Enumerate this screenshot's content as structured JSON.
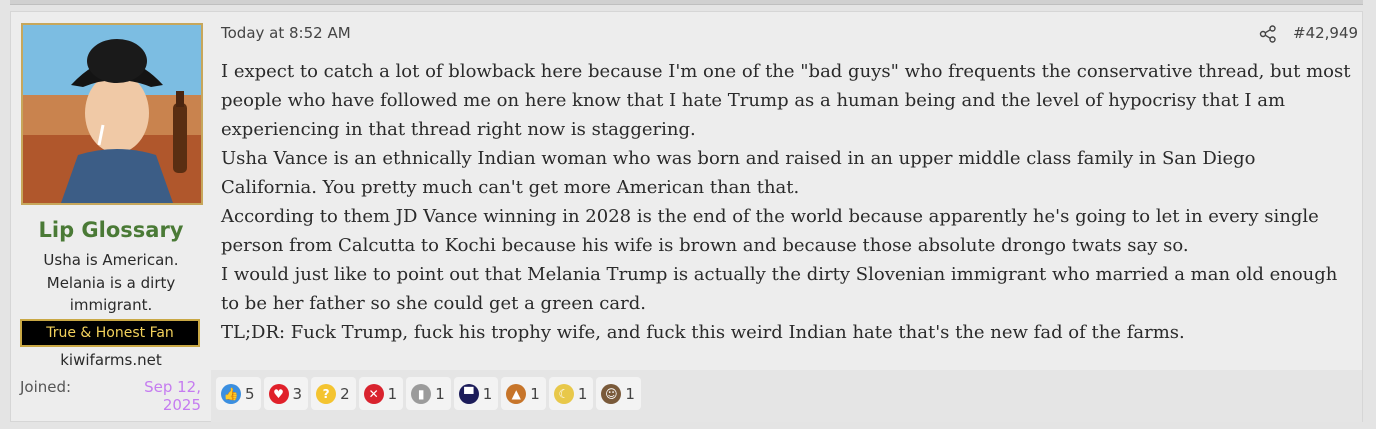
{
  "user": {
    "name": "Lip Glossary",
    "title": "Usha is American. Melania is a dirty immigrant.",
    "banner": "True & Honest Fan",
    "website": "kiwifarms.net",
    "joined_label": "Joined:",
    "joined_date": "Sep 12, 2025"
  },
  "post": {
    "timestamp": "Today at 8:52 AM",
    "number": "#42,949",
    "paragraphs": [
      "I expect to catch a lot of blowback here because I'm one of the \"bad guys\" who frequents the conservative thread, but most people who have followed me on here know that I hate Trump as a human being and the level of hypocrisy that I am experiencing in that thread right now is staggering.",
      "Usha Vance is an ethnically Indian woman who was born and raised in an upper middle class family in San Diego California. You pretty much can't get more American than that.",
      "According to them JD Vance winning in 2028 is the end of the world because apparently he's going to let in every single person from Calcutta to Kochi because his wife is brown and because those absolute drongo twats say so.",
      "I would just like to point out that Melania Trump is actually the dirty Slovenian immigrant who married a man old enough to be her father so she could get a green card.",
      "TL;DR: Fuck Trump, fuck his trophy wife, and fuck this weird Indian hate that's the new fad of the farms."
    ]
  },
  "reactions": [
    {
      "icon": "like-icon",
      "count": "5",
      "color": "#3b8fe0",
      "glyph": "👍"
    },
    {
      "icon": "heart-icon",
      "count": "3",
      "color": "#e0202a",
      "glyph": "♥"
    },
    {
      "icon": "thinking-icon",
      "count": "2",
      "color": "#f4c430",
      "glyph": "?"
    },
    {
      "icon": "x-icon",
      "count": "1",
      "color": "#d9232e",
      "glyph": "✕"
    },
    {
      "icon": "tombstone-icon",
      "count": "1",
      "color": "#9b9b9b",
      "glyph": "▮"
    },
    {
      "icon": "top-hat-icon",
      "count": "1",
      "color": "#1c1c5a",
      "glyph": "▀"
    },
    {
      "icon": "indian-flag-icon",
      "count": "1",
      "color": "#c7752a",
      "glyph": "▲"
    },
    {
      "icon": "crescent-moon-icon",
      "count": "1",
      "color": "#e8c84a",
      "glyph": "☾"
    },
    {
      "icon": "face-icon",
      "count": "1",
      "color": "#7a5a3a",
      "glyph": "☺"
    }
  ]
}
